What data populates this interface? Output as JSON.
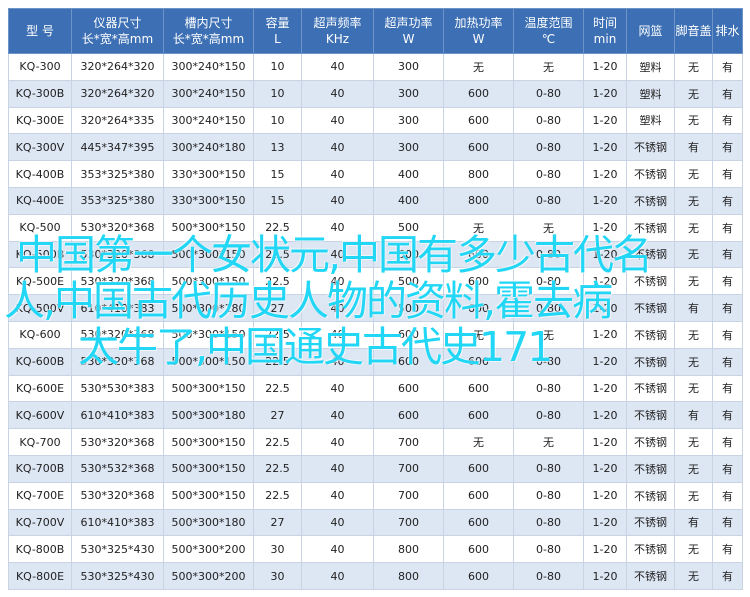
{
  "table": {
    "headers": [
      {
        "l1": "型 号",
        "l2": ""
      },
      {
        "l1": "仪器尺寸",
        "l2": "长*宽*高mm"
      },
      {
        "l1": "槽内尺寸",
        "l2": "长*宽*高mm"
      },
      {
        "l1": "容量",
        "l2": "L"
      },
      {
        "l1": "超声频率",
        "l2": "KHz"
      },
      {
        "l1": "超声功率",
        "l2": "W"
      },
      {
        "l1": "加热功率",
        "l2": "W"
      },
      {
        "l1": "温度范围",
        "l2": "℃"
      },
      {
        "l1": "时间",
        "l2": "min"
      },
      {
        "l1": "网篮",
        "l2": ""
      },
      {
        "l1": "脚音盖",
        "l2": ""
      },
      {
        "l1": "排水",
        "l2": ""
      }
    ],
    "rows": [
      [
        "KQ-300",
        "320*264*320",
        "300*240*150",
        "10",
        "40",
        "300",
        "无",
        "无",
        "1-20",
        "塑料",
        "无",
        "有"
      ],
      [
        "KQ-300B",
        "320*264*320",
        "300*240*150",
        "10",
        "40",
        "300",
        "600",
        "0-80",
        "1-20",
        "塑料",
        "无",
        "有"
      ],
      [
        "KQ-300E",
        "320*264*335",
        "300*240*150",
        "10",
        "40",
        "300",
        "600",
        "0-80",
        "1-20",
        "塑料",
        "无",
        "有"
      ],
      [
        "KQ-300V",
        "445*347*395",
        "300*240*180",
        "13",
        "40",
        "300",
        "600",
        "0-80",
        "1-20",
        "不锈钢",
        "有",
        "有"
      ],
      [
        "KQ-400B",
        "353*325*380",
        "330*300*150",
        "15",
        "40",
        "400",
        "800",
        "0-80",
        "1-20",
        "不锈钢",
        "无",
        "有"
      ],
      [
        "KQ-400E",
        "353*325*380",
        "330*300*150",
        "15",
        "40",
        "400",
        "800",
        "0-80",
        "1-20",
        "不锈钢",
        "无",
        "有"
      ],
      [
        "KQ-500",
        "530*320*368",
        "500*300*150",
        "22.5",
        "40",
        "500",
        "无",
        "无",
        "1-20",
        "不锈钢",
        "无",
        "有"
      ],
      [
        "KQ-500B",
        "530*320*368",
        "500*300*150",
        "22.5",
        "40",
        "500",
        "600",
        "0-80",
        "1-20",
        "不锈钢",
        "无",
        "有"
      ],
      [
        "KQ-500E",
        "530*320*368",
        "500*300*150",
        "22.5",
        "40",
        "500",
        "600",
        "0-80",
        "1-20",
        "不锈钢",
        "无",
        "有"
      ],
      [
        "KQ-500V",
        "610*410*383",
        "500*300*180",
        "27",
        "40",
        "500",
        "600",
        "0-80",
        "1-20",
        "不锈钢",
        "有",
        "有"
      ],
      [
        "KQ-600",
        "530*320*368",
        "500*300*150",
        "22.5",
        "40",
        "600",
        "无",
        "无",
        "1-20",
        "不锈钢",
        "无",
        "有"
      ],
      [
        "KQ-600B",
        "530*320*368",
        "500*300*150",
        "22.5",
        "40",
        "600",
        "600",
        "0-80",
        "1-20",
        "不锈钢",
        "无",
        "有"
      ],
      [
        "KQ-600E",
        "530*530*383",
        "500*300*150",
        "22.5",
        "40",
        "600",
        "600",
        "0-80",
        "1-20",
        "不锈钢",
        "无",
        "有"
      ],
      [
        "KQ-600V",
        "610*410*383",
        "500*300*180",
        "27",
        "40",
        "600",
        "600",
        "0-80",
        "1-20",
        "不锈钢",
        "有",
        "有"
      ],
      [
        "KQ-700",
        "530*320*368",
        "500*300*150",
        "22.5",
        "40",
        "700",
        "无",
        "无",
        "1-20",
        "不锈钢",
        "无",
        "有"
      ],
      [
        "KQ-700B",
        "530*532*368",
        "500*300*150",
        "22.5",
        "40",
        "700",
        "600",
        "0-80",
        "1-20",
        "不锈钢",
        "无",
        "有"
      ],
      [
        "KQ-700E",
        "530*320*368",
        "500*300*150",
        "22.5",
        "40",
        "700",
        "600",
        "0-80",
        "1-20",
        "不锈钢",
        "无",
        "有"
      ],
      [
        "KQ-700V",
        "610*410*383",
        "500*300*180",
        "27",
        "40",
        "700",
        "600",
        "0-80",
        "1-20",
        "不锈钢",
        "有",
        "有"
      ],
      [
        "KQ-800B",
        "530*325*430",
        "500*300*200",
        "30",
        "40",
        "800",
        "600",
        "0-80",
        "1-20",
        "不锈钢",
        "无",
        "有"
      ],
      [
        "KQ-800E",
        "530*325*430",
        "500*300*200",
        "30",
        "40",
        "800",
        "600",
        "0-80",
        "1-20",
        "不锈钢",
        "无",
        "有"
      ]
    ]
  },
  "overlay_lines": [
    "中国第一个女状元,中国有多少古代名",
    "人,中国古代历史人物的资料,霍去病",
    "太牛了,中国通史古代史171"
  ],
  "colors": {
    "header_bg": "#3c6fb4",
    "header_text": "#ffffff",
    "row_alt_bg": "#dde6f3",
    "overlay_text": "#22d6f5"
  }
}
